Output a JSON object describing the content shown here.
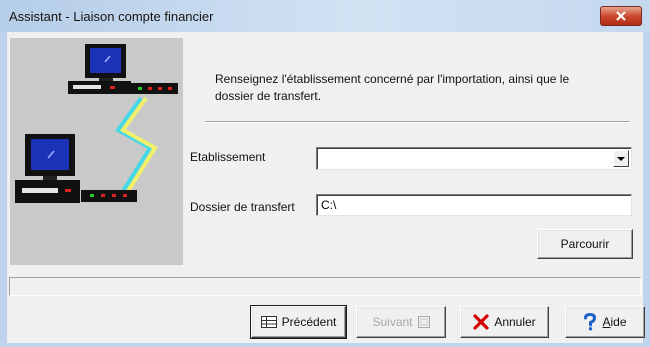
{
  "window": {
    "title": "Assistant - Liaison compte financier",
    "close_icon": "close-icon"
  },
  "illustration": {
    "icons": [
      "computer-icon",
      "network-device-icon",
      "lightning-bolt-icon"
    ]
  },
  "intro": {
    "line1": "Renseignez l'établissement concerné par l'importation, ainsi que le",
    "line2": "dossier de transfert."
  },
  "form": {
    "etablissement": {
      "label": "Etablissement",
      "value": ""
    },
    "dossier_transfert": {
      "label": "Dossier de transfert",
      "value": "C:\\"
    },
    "browse_button": "Parcourir"
  },
  "navigation": {
    "previous": {
      "label": "Précédent",
      "icon": "previous-icon",
      "enabled": true
    },
    "next": {
      "label": "Suivant",
      "icon": "next-icon",
      "enabled": false
    },
    "cancel": {
      "label": "Annuler",
      "icon": "cancel-icon",
      "enabled": true
    },
    "help": {
      "label": "Aide",
      "icon": "help-icon",
      "enabled": true
    }
  },
  "colors": {
    "title_bar": "#c4d8ee",
    "close_button": "#cc4a30",
    "screen_blue": "#1c33b8",
    "cancel_icon": "#d40000",
    "help_icon": "#1b5fc9",
    "bolt_yellow": "#f2f06a",
    "bolt_cyan": "#45d8e6"
  }
}
